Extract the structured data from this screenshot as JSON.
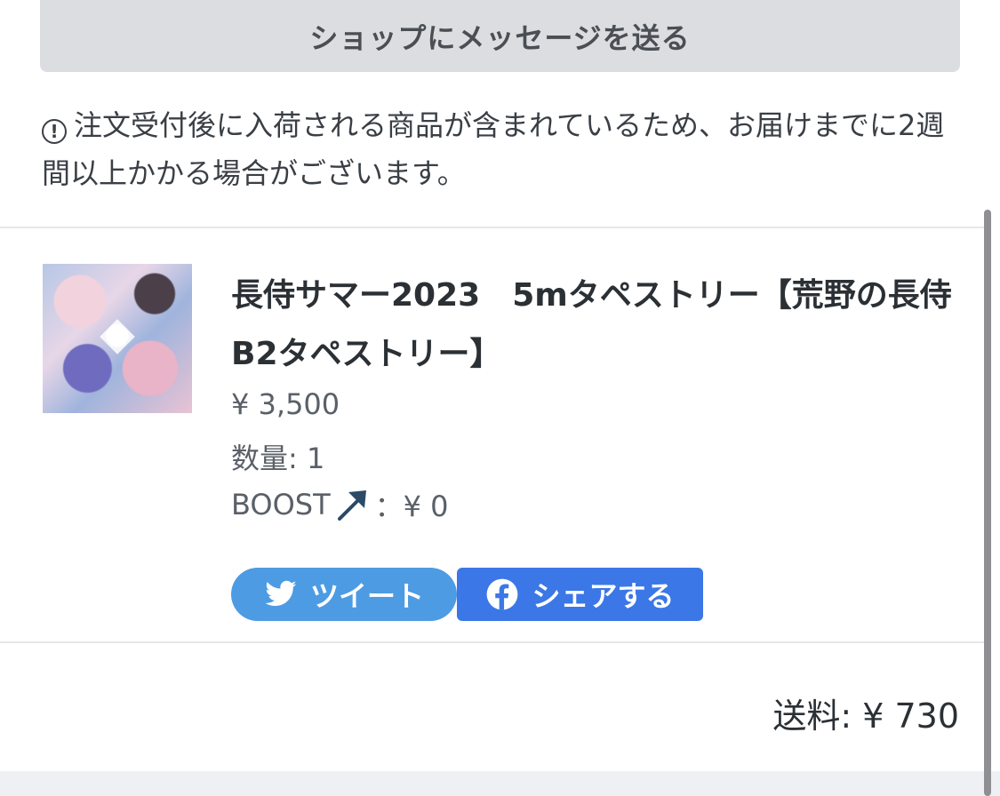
{
  "message_button": {
    "label": "ショップにメッセージを送る"
  },
  "notice": {
    "icon": "info-circle-icon",
    "text": "注文受付後に入荷される商品が含まれているため、お届けまでに2週間以上かかる場合がございます。"
  },
  "product": {
    "title": "長侍サマー2023　5mタペストリー【荒野の長侍B2タペストリー】",
    "price": "¥ 3,500",
    "quantity": "数量: 1",
    "boost_label": "BOOST",
    "boost_value": "：¥ 0"
  },
  "share": {
    "tweet_label": "ツイート",
    "facebook_label": "シェアする"
  },
  "shipping": {
    "text": "送料: ¥ 730"
  },
  "colors": {
    "twitter": "#4d9be3",
    "facebook": "#3b77e6",
    "message_button_bg": "#dcdde0"
  }
}
